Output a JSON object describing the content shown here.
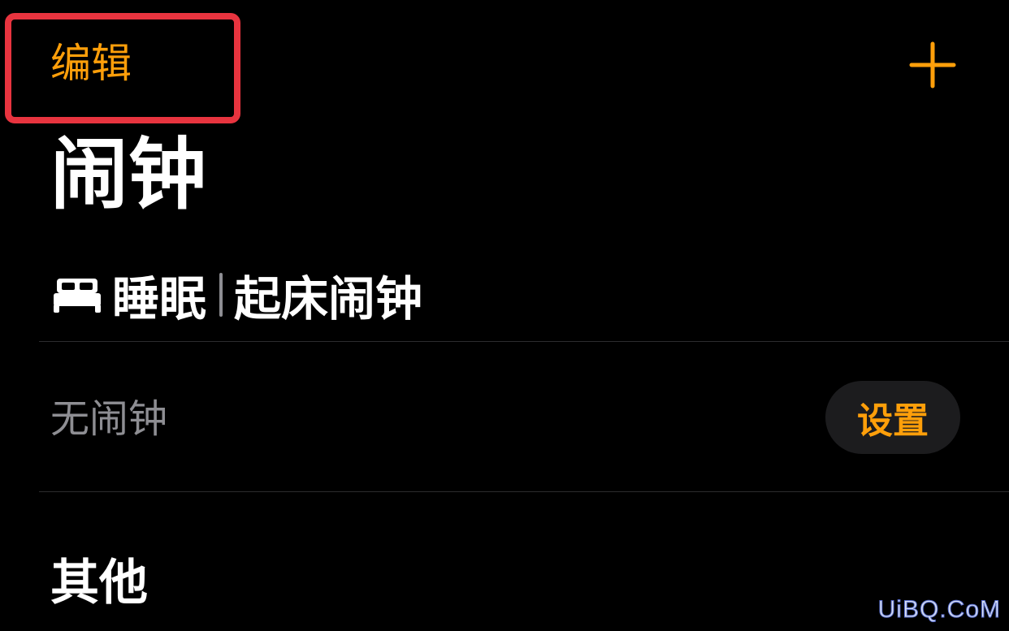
{
  "header": {
    "edit_label": "编辑",
    "add_icon": "plus-icon"
  },
  "page_title": "闹钟",
  "sleep_section": {
    "icon": "bed-icon",
    "title": "睡眠",
    "subtitle": "起床闹钟",
    "no_alarm_text": "无闹钟",
    "set_label": "设置"
  },
  "other_section": {
    "title": "其他"
  },
  "watermark": {
    "text": "UiBQ.CoM"
  },
  "colors": {
    "accent": "#ff9f0a",
    "background": "#000000",
    "secondary_text": "#8e8e93",
    "button_bg": "#1c1c1e",
    "highlight_border": "#e8343f"
  }
}
